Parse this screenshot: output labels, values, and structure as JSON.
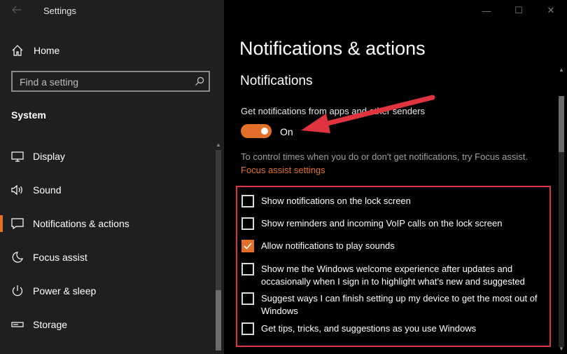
{
  "window": {
    "title": "Settings",
    "controls": {
      "minimize": "—",
      "maximize": "☐",
      "close": "✕"
    }
  },
  "sidebar": {
    "home_label": "Home",
    "search_placeholder": "Find a setting",
    "section": "System",
    "items": [
      {
        "label": "Display",
        "icon": "display-icon"
      },
      {
        "label": "Sound",
        "icon": "speaker-icon"
      },
      {
        "label": "Notifications & actions",
        "icon": "notification-icon",
        "selected": true
      },
      {
        "label": "Focus assist",
        "icon": "moon-icon"
      },
      {
        "label": "Power & sleep",
        "icon": "power-icon"
      },
      {
        "label": "Storage",
        "icon": "storage-icon"
      }
    ]
  },
  "main": {
    "title": "Notifications & actions",
    "subtitle": "Notifications",
    "toggle_description": "Get notifications from apps and other senders",
    "toggle_state": "On",
    "toggle_on": true,
    "info_text": "To control times when you do or don't get notifications, try Focus assist.",
    "info_link": "Focus assist settings",
    "checkboxes": [
      {
        "label": "Show notifications on the lock screen",
        "checked": false
      },
      {
        "label": "Show reminders and incoming VoIP calls on the lock screen",
        "checked": false
      },
      {
        "label": "Allow notifications to play sounds",
        "checked": true
      },
      {
        "label": "Show me the Windows welcome experience after updates and occasionally when I sign in to highlight what's new and suggested",
        "checked": false
      },
      {
        "label": "Suggest ways I can finish setting up my device to get the most out of Windows",
        "checked": false
      },
      {
        "label": "Get tips, tricks, and suggestions as you use Windows",
        "checked": false
      }
    ]
  },
  "colors": {
    "accent": "#e3702a",
    "annotation_red": "#e03540",
    "sidebar_bg": "#1f1f1f",
    "main_bg": "#000000"
  }
}
